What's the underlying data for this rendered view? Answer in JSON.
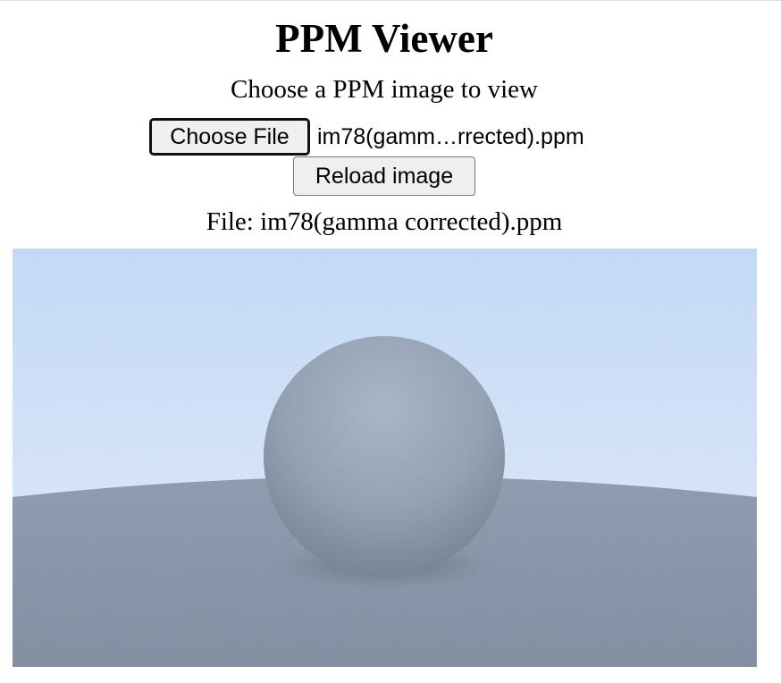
{
  "header": {
    "title": "PPM Viewer",
    "subtitle": "Choose a PPM image to view"
  },
  "file_input": {
    "button_label": "Choose File",
    "selected_file": "im78(gamm…rrected).ppm"
  },
  "reload_button": {
    "label": "Reload image"
  },
  "file_info": {
    "label": "File: im78(gamma corrected).ppm"
  },
  "colors": {
    "sky_top": "#c3dbfb",
    "sky_bottom": "#e6eefa",
    "ground_light": "#8c9bb0",
    "ground_dark": "#7c8a9e",
    "sphere_light": "#a5b1c2",
    "sphere_dark": "#6f7c8f",
    "button_bg": "#efefef"
  }
}
